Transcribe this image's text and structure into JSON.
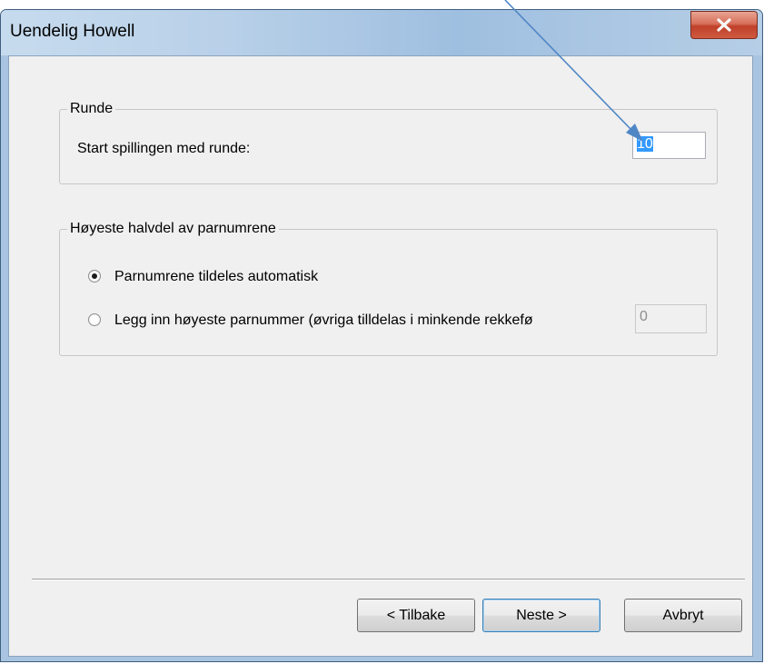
{
  "window": {
    "title": "Uendelig Howell"
  },
  "icons": {
    "close": "close-icon",
    "arrow": "annotation-arrow"
  },
  "colors": {
    "selection": "#3399ff",
    "arrow": "#4f86c6",
    "close_button": "#c8462f"
  },
  "runde": {
    "legend": "Runde",
    "label": "Start spillingen med runde:",
    "value": "10"
  },
  "hoyeste": {
    "legend": "Høyeste halvdel av parnumrene",
    "option_auto": {
      "label": "Parnumrene tildeles automatisk",
      "selected": true
    },
    "option_manual": {
      "label": "Legg inn høyeste parnummer (øvriga tilldelas i minkende rekkefø",
      "selected": false
    },
    "manual_value": "0"
  },
  "buttons": {
    "back": "< Tilbake",
    "next": "Neste >",
    "cancel": "Avbryt"
  }
}
